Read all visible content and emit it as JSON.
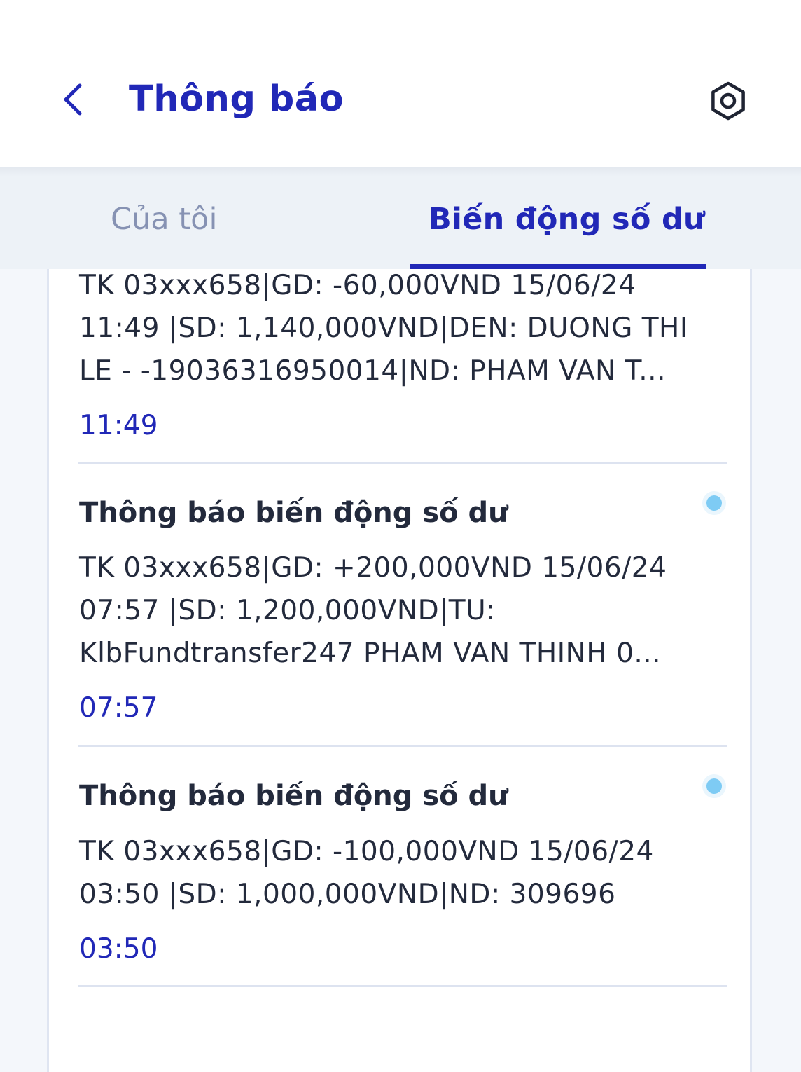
{
  "header": {
    "title": "Thông báo",
    "back_icon": "chevron-left-icon",
    "settings_icon": "gear-icon"
  },
  "tabs": [
    {
      "label": "Của tôi",
      "active": false
    },
    {
      "label": "Biến động số dư",
      "active": true
    }
  ],
  "notifications": [
    {
      "title": "",
      "lines": [
        "TK 03xxx658|GD: -60,000VND 15/06/24",
        "11:49 |SD: 1,140,000VND|DEN: DUONG THI",
        "LE - -19036316950014|ND: PHAM VAN T..."
      ],
      "time": "11:49",
      "unread": false
    },
    {
      "title": "Thông báo biến động số dư",
      "lines": [
        "TK 03xxx658|GD: +200,000VND 15/06/24",
        "07:57 |SD: 1,200,000VND|TU:",
        "KlbFundtransfer247 PHAM VAN THINH 0..."
      ],
      "time": "07:57",
      "unread": true
    },
    {
      "title": "Thông báo biến động số dư",
      "lines": [
        "TK 03xxx658|GD: -100,000VND 15/06/24",
        "03:50 |SD: 1,000,000VND|ND: 309696"
      ],
      "time": "03:50",
      "unread": true
    }
  ],
  "colors": {
    "accent": "#2128b7",
    "text": "#232a3c",
    "inactive_tab": "#8692b3",
    "unread_dot": "#7ecbf4",
    "divider": "#dde3f0"
  }
}
